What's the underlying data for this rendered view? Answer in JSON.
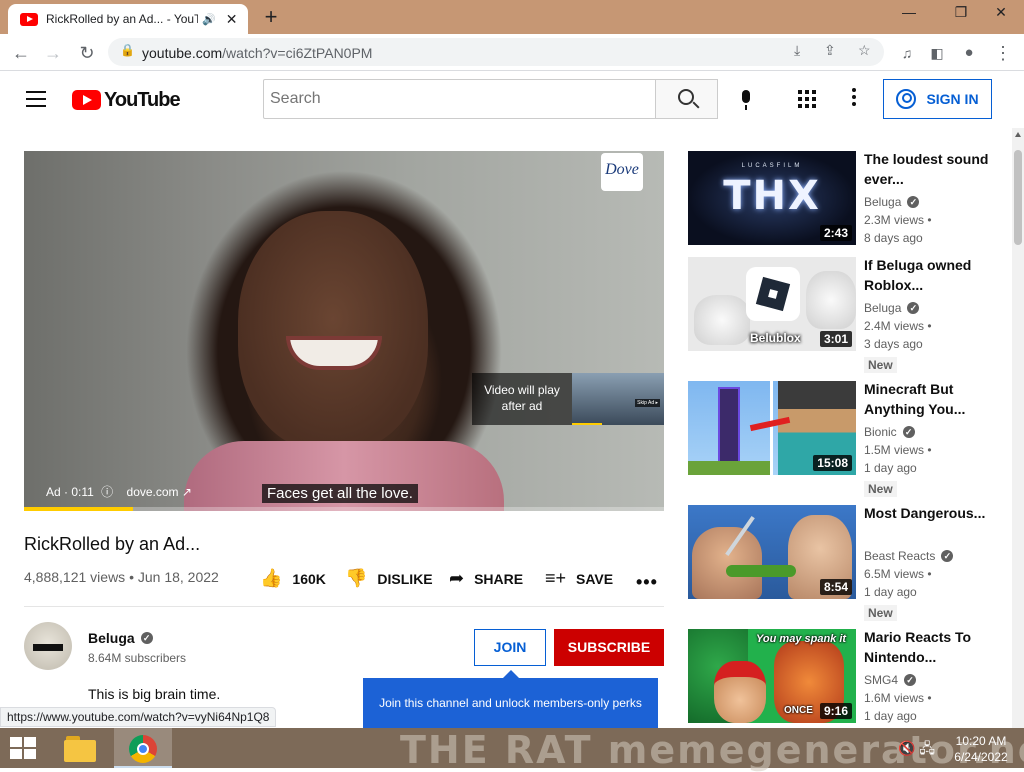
{
  "browser": {
    "tab_title": "RickRolled by an Ad... - YouT",
    "tab_audio_icon": "speaker-icon",
    "close_tab": "✕",
    "new_tab": "+",
    "window_controls": {
      "minimize": "—",
      "restore": "❐",
      "close": "✕"
    },
    "url_host": "youtube.com",
    "url_path": "/watch?v=ci6ZtPAN0PM",
    "status_url": "https://www.youtube.com/watch?v=vyNi64Np1Q8"
  },
  "header": {
    "logo_text": "YouTube",
    "search_placeholder": "Search",
    "sign_in": "SIGN IN"
  },
  "player": {
    "brand_badge": "Dove",
    "ad_label": "Ad · 0:11",
    "ad_info_icon": "ⓘ",
    "ad_url": "dove.com",
    "caption": "Faces get all the love.",
    "video_will_play": "Video will play after ad",
    "skip_label": "Skip Ad ▸",
    "ad_progress": 0.17
  },
  "video": {
    "title": "RickRolled by an Ad...",
    "meta": "4,888,121 views • Jun 18, 2022",
    "likes": "160K",
    "dislike": "DISLIKE",
    "share": "SHARE",
    "save": "SAVE",
    "more": "•••"
  },
  "channel": {
    "name": "Beluga",
    "subscribers": "8.64M subscribers",
    "join": "JOIN",
    "subscribe": "SUBSCRIBE",
    "description": "This is big brain time.",
    "join_tooltip": "Join this channel and unlock members-only perks"
  },
  "recommendations": [
    {
      "title": "The loudest sound ever...",
      "channel": "Beluga",
      "verified": true,
      "views": "2.3M views •",
      "age": "8 days ago",
      "duration": "2:43",
      "thumb_text": "THX",
      "thumb_top": "LUCASFILM",
      "new": ""
    },
    {
      "title": "If Beluga owned Roblox...",
      "channel": "Beluga",
      "verified": true,
      "views": "2.4M views •",
      "age": "3 days ago",
      "duration": "3:01",
      "thumb_text": "Belublox",
      "new": "New"
    },
    {
      "title": "Minecraft But Anything You...",
      "channel": "Bionic",
      "verified": true,
      "views": "1.5M views •",
      "age": "1 day ago",
      "duration": "15:08",
      "new": "New"
    },
    {
      "title": "Most Dangerous...",
      "channel": "Beast Reacts",
      "verified": true,
      "views": "6.5M views •",
      "age": "1 day ago",
      "duration": "8:54",
      "new": "New"
    },
    {
      "title": "Mario Reacts To Nintendo...",
      "channel": "SMG4",
      "verified": true,
      "views": "1.6M views •",
      "age": "1 day ago",
      "duration": "9:16",
      "thumb_text": "You may spank it",
      "thumb_text2": "ONCE",
      "new": ""
    }
  ],
  "taskbar": {
    "watermark": "THE RAT  memegenerator.net",
    "time": "10:20 AM",
    "date": "6/24/2022",
    "tray": "🔇 🖧"
  },
  "colors": {
    "youtube_red": "#ff0000",
    "subscribe_red": "#cc0000",
    "link_blue": "#065fd4",
    "ad_yellow": "#ffcc00",
    "tab_strip": "#c69774",
    "tooltip_blue": "#1c62d6"
  }
}
